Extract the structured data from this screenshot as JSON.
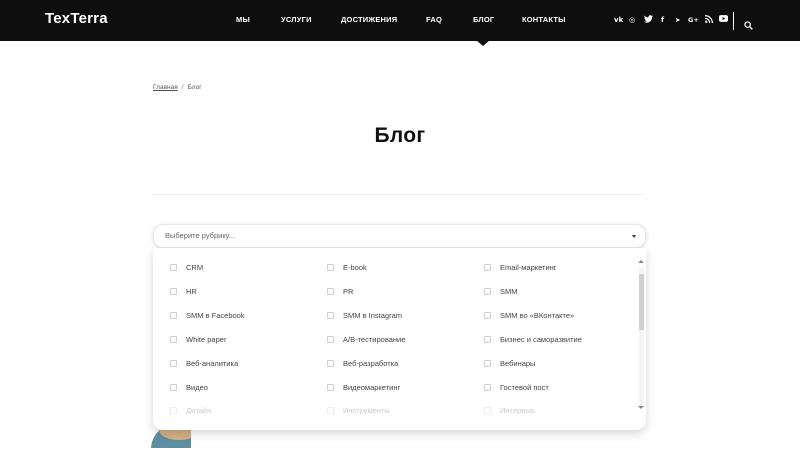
{
  "header": {
    "logo": "TexTerra",
    "nav": [
      {
        "label": "МЫ",
        "active": false
      },
      {
        "label": "УСЛУГИ",
        "active": false
      },
      {
        "label": "ДОСТИЖЕНИЯ",
        "active": false
      },
      {
        "label": "FAQ",
        "active": false
      },
      {
        "label": "БЛОГ",
        "active": true
      },
      {
        "label": "КОНТАКТЫ",
        "active": false
      }
    ],
    "social": [
      {
        "icon": "vk-icon",
        "glyph": "vk"
      },
      {
        "icon": "instagram-icon",
        "glyph": "◎"
      },
      {
        "icon": "twitter-icon",
        "glyph": "🐦"
      },
      {
        "icon": "facebook-icon",
        "glyph": "f"
      },
      {
        "icon": "telegram-icon",
        "glyph": "➤"
      },
      {
        "icon": "google-plus-icon",
        "glyph": "G+"
      },
      {
        "icon": "rss-icon",
        "glyph": "))"
      },
      {
        "icon": "youtube-icon",
        "glyph": "▶"
      }
    ],
    "search_icon": "search-icon",
    "background": "#0e0e0e"
  },
  "breadcrumb": {
    "home": "Главная",
    "separator": "/",
    "current": "Блог"
  },
  "page": {
    "title": "Блог"
  },
  "category_select": {
    "placeholder": "Выберите рубрику...",
    "options": [
      "CRM",
      "E-book",
      "Email-маркетинг",
      "HR",
      "PR",
      "SMM",
      "SMM в Facebook",
      "SMM в Instagram",
      "SMM во «ВКонтакте»",
      "White paper",
      "A/B-тестирование",
      "Бизнес и саморазвитие",
      "Веб-аналитика",
      "Веб-разработка",
      "Вебинары",
      "Видео",
      "Видеомаркетинг",
      "Гостевой пост",
      "Дизайн",
      "Инструменты",
      "Интервью"
    ]
  }
}
